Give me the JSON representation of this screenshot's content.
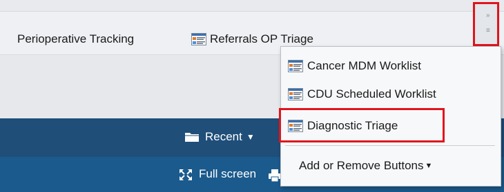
{
  "toolbar": {
    "items": [
      {
        "label": "Perioperative Tracking",
        "has_icon": false
      },
      {
        "label": "Referrals OP Triage",
        "has_icon": true,
        "icon": "worklist-icon"
      }
    ],
    "overflow_icon": "chevron-overflow-icon"
  },
  "dropdown": {
    "items": [
      {
        "label": "Cancer MDM Worklist",
        "icon": "worklist-icon"
      },
      {
        "label": "CDU Scheduled Worklist",
        "icon": "worklist-icon"
      },
      {
        "label": "Diagnostic Triage",
        "icon": "worklist-icon",
        "highlighted": true
      }
    ],
    "add_remove_label": "Add or Remove Buttons",
    "add_remove_icon": "caret-down-icon"
  },
  "nav": {
    "recent_label": "Recent",
    "recent_icon": "folder-icon",
    "fullscreen_label": "Full screen",
    "fullscreen_icon": "expand-icon",
    "print_icon": "print-icon"
  },
  "colors": {
    "highlight": "#e0141b",
    "nav_dark": "#1f4e79",
    "nav_mid": "#1b5a8c"
  }
}
